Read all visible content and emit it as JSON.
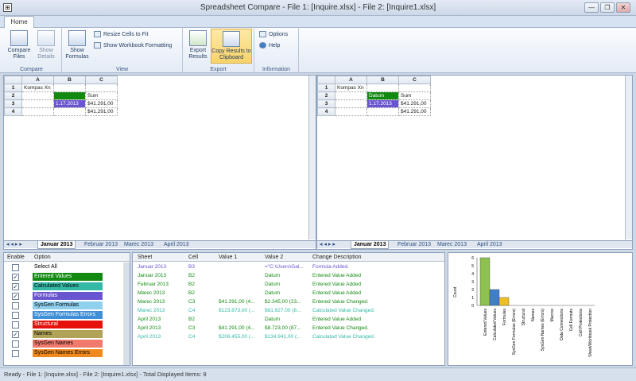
{
  "window": {
    "title": "Spreadsheet Compare - File 1: [Inquire.xlsx] - File 2: [Inquire1.xlsx]",
    "min": "—",
    "restore": "❐",
    "close": "✕"
  },
  "ribbon": {
    "tab": "Home",
    "compare": {
      "compare_files": "Compare Files",
      "show_details": "Show Details",
      "label": "Compare"
    },
    "view": {
      "show_formulas": "Show Formulas",
      "resize": "Resize Cells to Fit",
      "show_formatting": "Show Workbook Formatting",
      "label": "View"
    },
    "export": {
      "export_results": "Export Results",
      "copy_clipboard": "Copy Results to Clipboard",
      "label": "Export"
    },
    "information": {
      "options": "Options",
      "help": "Help",
      "label": "Information"
    }
  },
  "left_grid": {
    "cols": [
      "",
      "A",
      "B",
      "C"
    ],
    "rows": [
      [
        "1",
        "Kompas Xn",
        "",
        ""
      ],
      [
        "2",
        "",
        "",
        "Sum"
      ],
      [
        "3",
        "",
        "1.17.2013",
        "$41.291,00"
      ],
      [
        "4",
        "",
        "",
        "$41.291,00"
      ]
    ]
  },
  "right_grid": {
    "cols": [
      "",
      "A",
      "B",
      "C"
    ],
    "rows": [
      [
        "1",
        "Kompas Xn",
        "",
        ""
      ],
      [
        "2",
        "",
        "Datum",
        "Sum"
      ],
      [
        "3",
        "",
        "1.17.2013",
        "$41.291,00"
      ],
      [
        "4",
        "",
        "",
        "$41.291,00"
      ]
    ]
  },
  "sheet_tabs": [
    "Januar 2013",
    "Februar 2013",
    "Marec 2013",
    "April 2013"
  ],
  "options_panel": {
    "enable_header": "Enable",
    "option_header": "Option",
    "items": [
      {
        "label": "Select All",
        "checked": false,
        "color": "#ffffff"
      },
      {
        "label": "Entered Values",
        "checked": true,
        "color": "#128a12"
      },
      {
        "label": "Calculated Values",
        "checked": true,
        "color": "#33b9a6"
      },
      {
        "label": "Formulas",
        "checked": true,
        "color": "#6a55d0"
      },
      {
        "label": "SysGen Formulas",
        "checked": false,
        "color": "#8fd0ee"
      },
      {
        "label": "SysGen Formulas Errors",
        "checked": false,
        "color": "#3f8fd8"
      },
      {
        "label": "Structural",
        "checked": false,
        "color": "#e8100b"
      },
      {
        "label": "Names",
        "checked": true,
        "color": "#b0a256"
      },
      {
        "label": "SysGen Names",
        "checked": false,
        "color": "#f07a6c"
      },
      {
        "label": "SysGen Names Errors",
        "checked": false,
        "color": "#f08a1e"
      }
    ]
  },
  "results": {
    "headers": [
      "Sheet",
      "Cell",
      "Value 1",
      "Value 2",
      "Change Description"
    ],
    "rows": [
      {
        "sheet": "Januar 2013",
        "cell": "B3",
        "v1": "",
        "v2": "=\"C:\\Users\\Gal...",
        "desc": "Formula Added.",
        "color": "#6a55d0"
      },
      {
        "sheet": "Januar 2013",
        "cell": "B2",
        "v1": "",
        "v2": "Datum",
        "desc": "Entered Value Added",
        "color": "#128a12"
      },
      {
        "sheet": "Februar 2013",
        "cell": "B2",
        "v1": "",
        "v2": "Datum",
        "desc": "Entered Value Added",
        "color": "#128a12"
      },
      {
        "sheet": "Marec 2013",
        "cell": "B2",
        "v1": "",
        "v2": "Datum",
        "desc": "Entered Value Added",
        "color": "#128a12"
      },
      {
        "sheet": "Marec 2013",
        "cell": "C3",
        "v1": "$41.291,00 (4...",
        "v2": "$2.345,00 (23...",
        "desc": "Entered Value Changed.",
        "color": "#128a12"
      },
      {
        "sheet": "Marec 2013",
        "cell": "C4",
        "v1": "$123.873,00 (...",
        "v2": "$81.927,00 (8...",
        "desc": "Calculated Value Changed.",
        "color": "#33b9a6"
      },
      {
        "sheet": "April 2013",
        "cell": "B2",
        "v1": "",
        "v2": "Datum",
        "desc": "Entered Value Added",
        "color": "#128a12"
      },
      {
        "sheet": "April 2013",
        "cell": "C3",
        "v1": "$41.291,00 (4...",
        "v2": "$8.723,00 (87...",
        "desc": "Entered Value Changed.",
        "color": "#128a12"
      },
      {
        "sheet": "April 2013",
        "cell": "C4",
        "v1": "$206.455,00 (...",
        "v2": "$134.941,00 (...",
        "desc": "Calculated Value Changed.",
        "color": "#33b9a6"
      }
    ]
  },
  "chart_data": {
    "type": "bar",
    "ylabel": "Count",
    "ylim": [
      0,
      6
    ],
    "yticks": [
      "0",
      "1",
      "2",
      "3",
      "4",
      "5",
      "6"
    ],
    "categories": [
      "Entered Values",
      "Calculated Values",
      "Formulas",
      "SysGen Formulas (Errors)",
      "Structural",
      "Names",
      "SysGen Names (Errors)",
      "Macros",
      "Data Connections",
      "Cell Formats",
      "Cell Protections",
      "Sheet/Workbook Protection"
    ],
    "values": [
      6,
      2,
      1,
      0,
      0,
      0,
      0,
      0,
      0,
      0,
      0,
      0
    ],
    "colors": [
      "#8ec050",
      "#3f7fc8",
      "#f0c020"
    ]
  },
  "status": "Ready - File 1: [Inquire.xlsx] - File 2: [Inquire1.xlsx] - Total Displayed Items: 9"
}
